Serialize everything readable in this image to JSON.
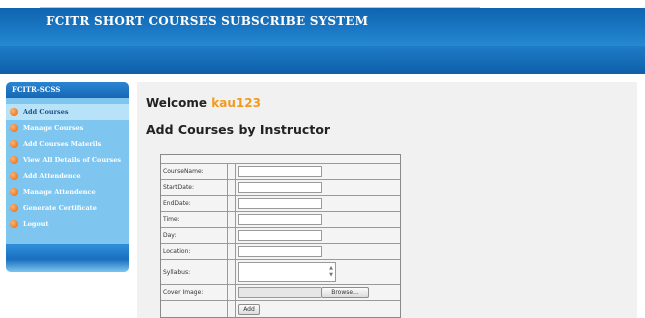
{
  "header": {
    "title": "FCITR SHORT COURSES SUBSCRIBE SYSTEM"
  },
  "sidebar": {
    "heading": "FCITR-SCSS",
    "items": [
      {
        "label": "Add Courses",
        "active": true
      },
      {
        "label": "Manage Courses",
        "active": false
      },
      {
        "label": "Add Courses Materils",
        "active": false
      },
      {
        "label": "View All Details of Courses",
        "active": false
      },
      {
        "label": "Add Attendence",
        "active": false
      },
      {
        "label": "Manage Attendence",
        "active": false
      },
      {
        "label": "Generate Certificate",
        "active": false
      },
      {
        "label": "Logout",
        "active": false
      }
    ]
  },
  "main": {
    "welcome_prefix": "Welcome",
    "username": "kau123",
    "section_title": "Add Courses by Instructor",
    "form": {
      "fields": [
        {
          "label": "CourseName:",
          "value": ""
        },
        {
          "label": "StartDate:",
          "value": ""
        },
        {
          "label": "EndDate:",
          "value": ""
        },
        {
          "label": "Time:",
          "value": ""
        },
        {
          "label": "Day:",
          "value": ""
        },
        {
          "label": "Location:",
          "value": ""
        }
      ],
      "syllabus_label": "Syllabus:",
      "cover_label": "Cover Image:",
      "browse_label": "Browse...",
      "submit_label": "Add"
    }
  },
  "colors": {
    "accent_username": "#f39a1e",
    "header_blue": "#1a78c4",
    "sidebar_blue": "#7ec6ef"
  }
}
